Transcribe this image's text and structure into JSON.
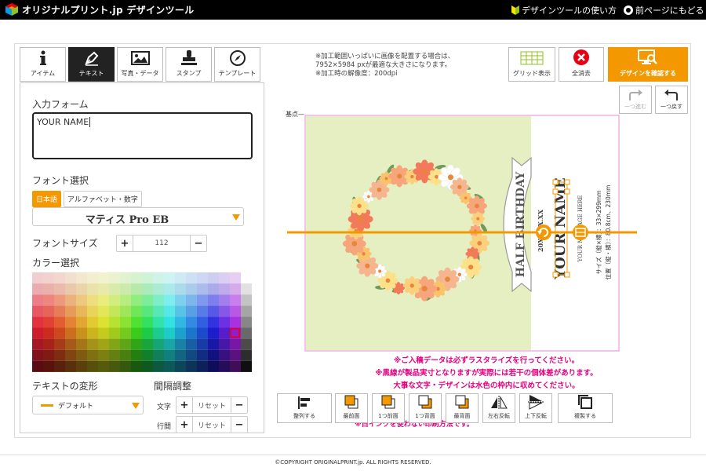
{
  "header": {
    "logo_text": "オリジナルプリント.jp デザインツール",
    "guide_link": "デザインツールの使い方",
    "back_link": "前ページにもどる"
  },
  "tool_tabs": [
    {
      "label": "アイテム",
      "icon": "info-icon"
    },
    {
      "label": "テキスト",
      "icon": "pen-icon",
      "active": true
    },
    {
      "label": "写真・データ",
      "icon": "image-icon"
    },
    {
      "label": "スタンプ",
      "icon": "stamp-icon"
    },
    {
      "label": "テンプレート",
      "icon": "compass-icon"
    }
  ],
  "left_panel": {
    "input_label": "入力フォーム",
    "input_value": "YOUR NAME",
    "font_label": "フォント選択",
    "font_tab_japanese": "日本語",
    "font_tab_alpha": "アルファベット・数字",
    "font_selected": "マティス Pro EB",
    "font_size_label": "フォントサイズ",
    "font_size_value": "112",
    "color_label": "カラー選択",
    "transform_label": "テキストの変形",
    "transform_value": "デフォルト",
    "spacing_label": "間隔調整",
    "char_label": "文字",
    "line_label": "行間",
    "reset_label": "リセット"
  },
  "notice_top": [
    "※加工範囲いっぱいに画像を配置する場合は、",
    "7952×5984 pxが最適な大きさになります。",
    "※加工時の解像度：200dpi"
  ],
  "actions": {
    "grid": "グリッド表示",
    "clear": "全消去",
    "confirm": "デザインを確認する",
    "redo": "一つ進む",
    "undo": "一つ戻す"
  },
  "canvas": {
    "origin_label": "基点",
    "banner_text": "HALF BIRTHDAY",
    "date_text": "20XX.XX.XX",
    "name_text": "YOUR NAME",
    "message_text": "YOUR MESSAGE HERE",
    "size_text": "サイズ（縦×横）：33×299mm",
    "position_text": "位置（縦・横）：80.8cm、230mm"
  },
  "notices": [
    "※ご入稿データは必ずラスタライズを行ってください。",
    "※黒線が製品実寸となりますが実際には若干の個体差があります。",
    "大事な文字・デザインは水色の枠内に収めてください。",
    "※白インクを使わない印刷方法です。"
  ],
  "bottom_tools": {
    "align": "整列する",
    "front": "最前面",
    "forward": "1つ前面",
    "backward": "1つ背面",
    "back": "最背面",
    "flip_h": "左右反転",
    "flip_v": "上下反転",
    "duplicate": "複製する"
  },
  "footer": "©COPYRIGHT ORIGINALPRINT.jp. ALL RIGHTS RESERVED.",
  "colors": {
    "accent": "#f39800",
    "canvas_bg": "#e6efc2",
    "guide_line": "#f39800",
    "notice": "#e4007f",
    "clear_icon": "#e60012"
  }
}
